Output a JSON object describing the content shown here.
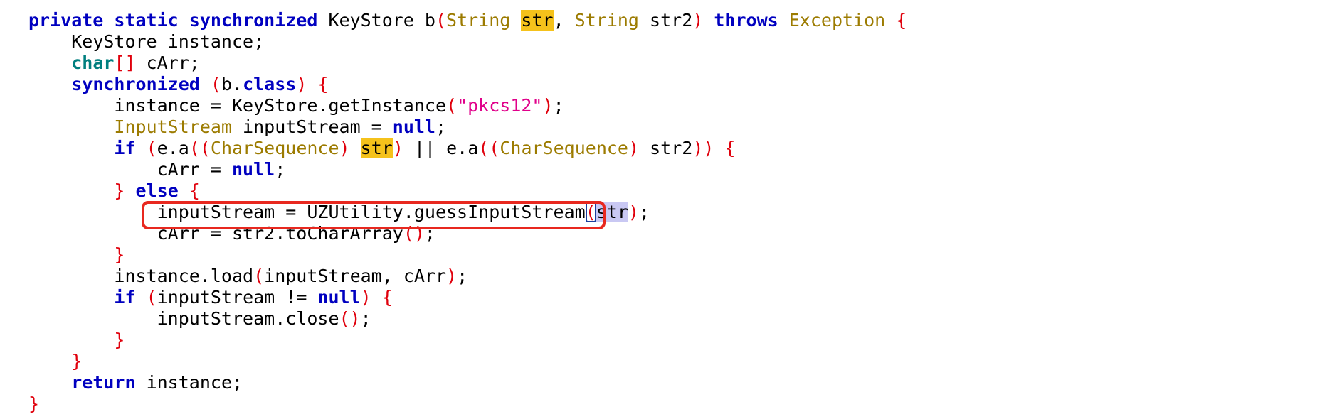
{
  "code": {
    "lines": [
      {
        "indent": 0,
        "tokens": [
          {
            "t": "private static synchronized",
            "c": "kw"
          },
          {
            "t": " KeyStore b",
            "c": "plain"
          },
          {
            "t": "(",
            "c": "punct"
          },
          {
            "t": "String",
            "c": "type"
          },
          {
            "t": " ",
            "c": "plain"
          },
          {
            "t": "str",
            "c": "hl"
          },
          {
            "t": ", ",
            "c": "plain"
          },
          {
            "t": "String",
            "c": "type"
          },
          {
            "t": " str2",
            "c": "plain"
          },
          {
            "t": ")",
            "c": "punct"
          },
          {
            "t": " ",
            "c": "plain"
          },
          {
            "t": "throws",
            "c": "kw"
          },
          {
            "t": " ",
            "c": "plain"
          },
          {
            "t": "Exception",
            "c": "type"
          },
          {
            "t": " ",
            "c": "plain"
          },
          {
            "t": "{",
            "c": "punct"
          }
        ]
      },
      {
        "indent": 1,
        "tokens": [
          {
            "t": "KeyStore instance;",
            "c": "plain"
          }
        ]
      },
      {
        "indent": 1,
        "tokens": [
          {
            "t": "char",
            "c": "kw-teal"
          },
          {
            "t": "[]",
            "c": "punct"
          },
          {
            "t": " cArr;",
            "c": "plain"
          }
        ]
      },
      {
        "indent": 1,
        "tokens": [
          {
            "t": "synchronized",
            "c": "kw"
          },
          {
            "t": " ",
            "c": "plain"
          },
          {
            "t": "(",
            "c": "punct"
          },
          {
            "t": "b.",
            "c": "plain"
          },
          {
            "t": "class",
            "c": "kw"
          },
          {
            "t": ")",
            "c": "punct"
          },
          {
            "t": " ",
            "c": "plain"
          },
          {
            "t": "{",
            "c": "punct"
          }
        ]
      },
      {
        "indent": 2,
        "tokens": [
          {
            "t": "instance = KeyStore.getInstance",
            "c": "plain"
          },
          {
            "t": "(",
            "c": "punct"
          },
          {
            "t": "\"pkcs12\"",
            "c": "str"
          },
          {
            "t": ")",
            "c": "punct"
          },
          {
            "t": ";",
            "c": "plain"
          }
        ]
      },
      {
        "indent": 2,
        "tokens": [
          {
            "t": "InputStream",
            "c": "type"
          },
          {
            "t": " inputStream = ",
            "c": "plain"
          },
          {
            "t": "null",
            "c": "kw"
          },
          {
            "t": ";",
            "c": "plain"
          }
        ]
      },
      {
        "indent": 2,
        "tokens": [
          {
            "t": "if",
            "c": "kw"
          },
          {
            "t": " ",
            "c": "plain"
          },
          {
            "t": "(",
            "c": "punct"
          },
          {
            "t": "e.a",
            "c": "plain"
          },
          {
            "t": "((",
            "c": "punct"
          },
          {
            "t": "CharSequence",
            "c": "type"
          },
          {
            "t": ")",
            "c": "punct"
          },
          {
            "t": " ",
            "c": "plain"
          },
          {
            "t": "str",
            "c": "hl"
          },
          {
            "t": ")",
            "c": "punct"
          },
          {
            "t": " || e.a",
            "c": "plain"
          },
          {
            "t": "((",
            "c": "punct"
          },
          {
            "t": "CharSequence",
            "c": "type"
          },
          {
            "t": ")",
            "c": "punct"
          },
          {
            "t": " str2",
            "c": "plain"
          },
          {
            "t": "))",
            "c": "punct"
          },
          {
            "t": " ",
            "c": "plain"
          },
          {
            "t": "{",
            "c": "punct"
          }
        ]
      },
      {
        "indent": 3,
        "tokens": [
          {
            "t": "cArr = ",
            "c": "plain"
          },
          {
            "t": "null",
            "c": "kw"
          },
          {
            "t": ";",
            "c": "plain"
          }
        ]
      },
      {
        "indent": 2,
        "tokens": [
          {
            "t": "}",
            "c": "punct"
          },
          {
            "t": " ",
            "c": "plain"
          },
          {
            "t": "else",
            "c": "kw"
          },
          {
            "t": " ",
            "c": "plain"
          },
          {
            "t": "{",
            "c": "punct"
          }
        ]
      },
      {
        "indent": 3,
        "tokens": [
          {
            "t": "inputStream = UZUtility.guessInputStream",
            "c": "plain"
          },
          {
            "t": "(",
            "c": "paren-match"
          },
          {
            "t": "str",
            "c": "hl-sel"
          },
          {
            "t": ")",
            "c": "punct"
          },
          {
            "t": ";",
            "c": "plain"
          }
        ]
      },
      {
        "indent": 3,
        "tokens": [
          {
            "t": "cArr = str2.toCharArray",
            "c": "plain"
          },
          {
            "t": "()",
            "c": "punct"
          },
          {
            "t": ";",
            "c": "plain"
          }
        ]
      },
      {
        "indent": 2,
        "tokens": [
          {
            "t": "}",
            "c": "punct"
          }
        ]
      },
      {
        "indent": 2,
        "tokens": [
          {
            "t": "instance.load",
            "c": "plain"
          },
          {
            "t": "(",
            "c": "punct"
          },
          {
            "t": "inputStream, cArr",
            "c": "plain"
          },
          {
            "t": ")",
            "c": "punct"
          },
          {
            "t": ";",
            "c": "plain"
          }
        ]
      },
      {
        "indent": 2,
        "tokens": [
          {
            "t": "if",
            "c": "kw"
          },
          {
            "t": " ",
            "c": "plain"
          },
          {
            "t": "(",
            "c": "punct"
          },
          {
            "t": "inputStream != ",
            "c": "plain"
          },
          {
            "t": "null",
            "c": "kw"
          },
          {
            "t": ")",
            "c": "punct"
          },
          {
            "t": " ",
            "c": "plain"
          },
          {
            "t": "{",
            "c": "punct"
          }
        ]
      },
      {
        "indent": 3,
        "tokens": [
          {
            "t": "inputStream.close",
            "c": "plain"
          },
          {
            "t": "()",
            "c": "punct"
          },
          {
            "t": ";",
            "c": "plain"
          }
        ]
      },
      {
        "indent": 2,
        "tokens": [
          {
            "t": "}",
            "c": "punct"
          }
        ]
      },
      {
        "indent": 1,
        "tokens": [
          {
            "t": "}",
            "c": "punct"
          }
        ]
      },
      {
        "indent": 1,
        "tokens": [
          {
            "t": "return",
            "c": "kw"
          },
          {
            "t": " instance;",
            "c": "plain"
          }
        ]
      },
      {
        "indent": 0,
        "tokens": [
          {
            "t": "}",
            "c": "punct"
          }
        ]
      }
    ]
  },
  "annotation": {
    "color": "#e8281f"
  },
  "colors": {
    "keyword": "#0000c0",
    "keyword_teal": "#007f7f",
    "type": "#9c7b00",
    "punctuation": "#e0000c",
    "string": "#e0008a",
    "occurrence_highlight": "#f5c21b",
    "selection_highlight": "#c9c8f3"
  }
}
